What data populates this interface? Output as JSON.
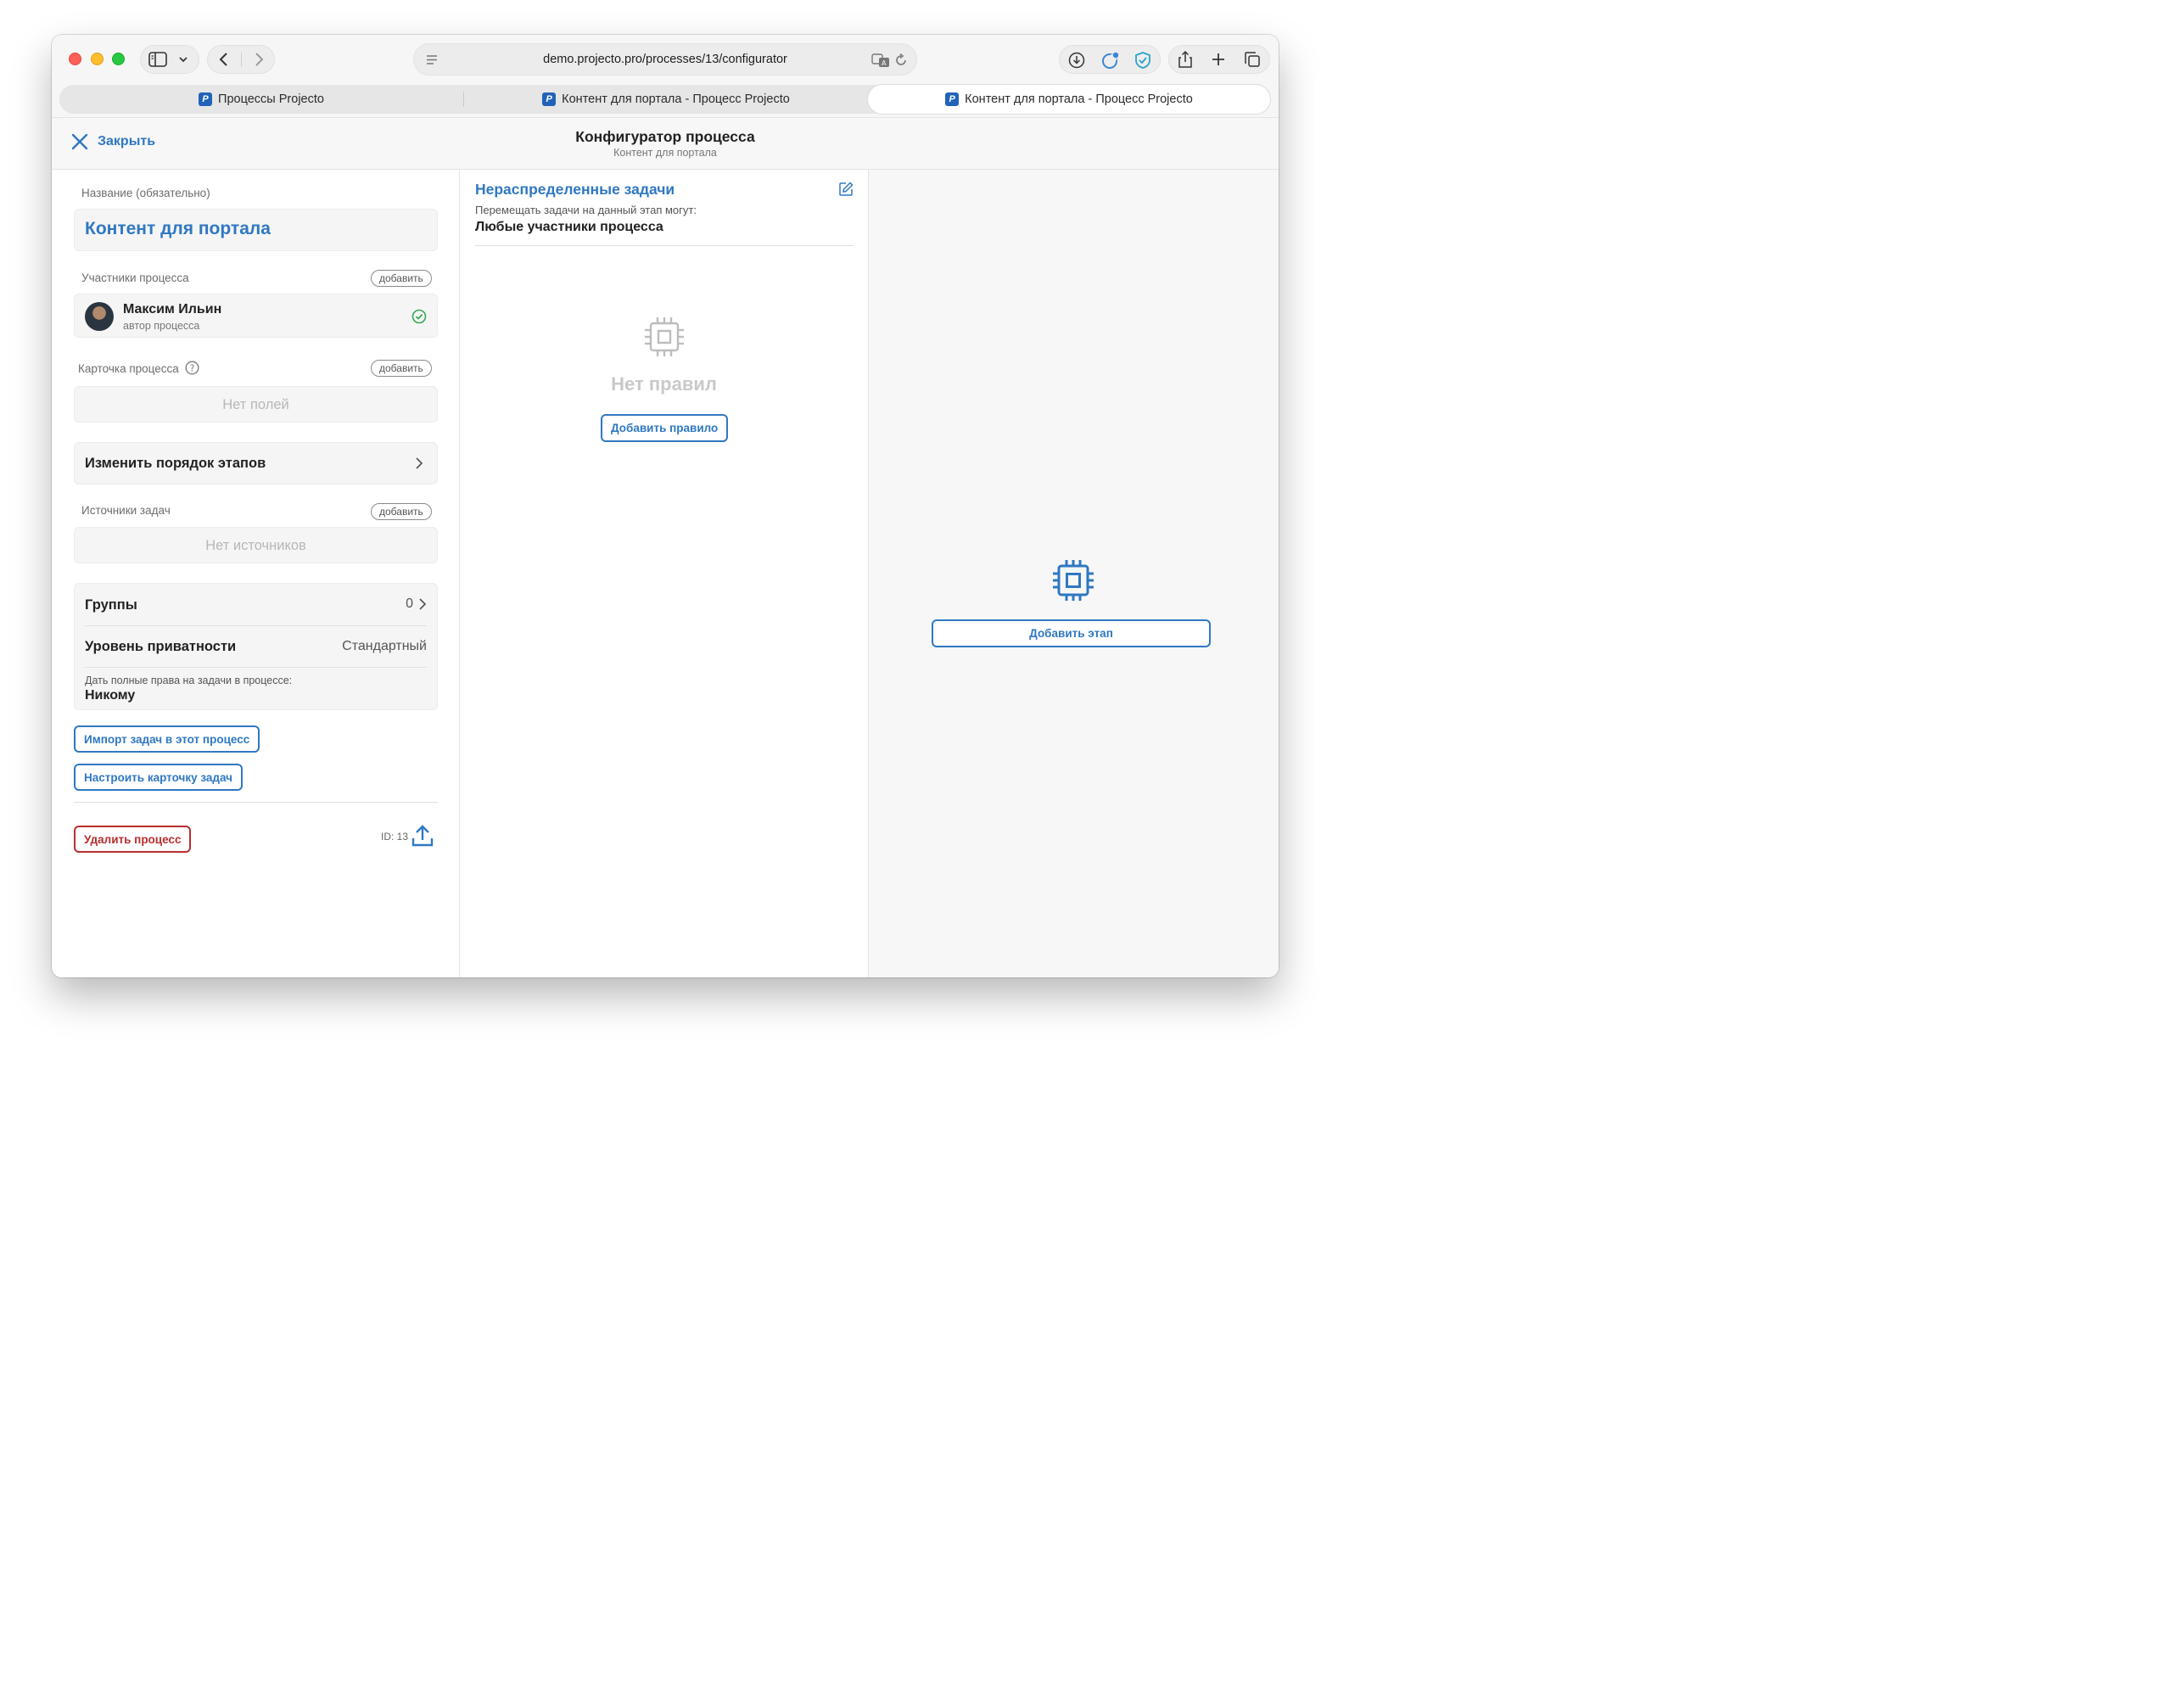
{
  "browser": {
    "url": "demo.projecto.pro/processes/13/configurator",
    "tabs": [
      {
        "label": "Процессы Projecto",
        "active": false
      },
      {
        "label": "Контент для портала - Процесс Projecto",
        "active": false
      },
      {
        "label": "Контент для портала - Процесс Projecto",
        "active": true
      }
    ],
    "favicon_letter": "P"
  },
  "header": {
    "close_label": "Закрыть",
    "title": "Конфигуратор процесса",
    "subtitle": "Контент для портала"
  },
  "settings": {
    "name_label": "Название (обязательно)",
    "name_value": "Контент для портала",
    "participants_label": "Участники процесса",
    "add_label": "добавить",
    "participant": {
      "name": "Максим Ильин",
      "role": "автор процесса"
    },
    "card_label": "Карточка процесса",
    "no_fields": "Нет полей",
    "reorder_label": "Изменить порядок этапов",
    "sources_label": "Источники задач",
    "no_sources": "Нет источников",
    "groups_label": "Группы",
    "groups_count": "0",
    "privacy_label": "Уровень приватности",
    "privacy_value": "Стандартный",
    "rights_label": "Дать полные права на задачи в процессе:",
    "rights_value": "Никому",
    "import_button": "Импорт задач в этот процесс",
    "configure_card_button": "Настроить карточку задач",
    "delete_button": "Удалить процесс",
    "id_label": "ID: 13"
  },
  "stage": {
    "title": "Нераспределенные задачи",
    "move_hint": "Перемещать задачи на данный этап могут:",
    "move_who": "Любые участники процесса",
    "no_rules": "Нет правил",
    "add_rule_button": "Добавить правило"
  },
  "add_stage": {
    "button": "Добавить этап"
  },
  "colors": {
    "accent": "#2f78c2",
    "danger": "#b92e2e",
    "success": "#34a853",
    "muted": "#b7b7b7"
  }
}
